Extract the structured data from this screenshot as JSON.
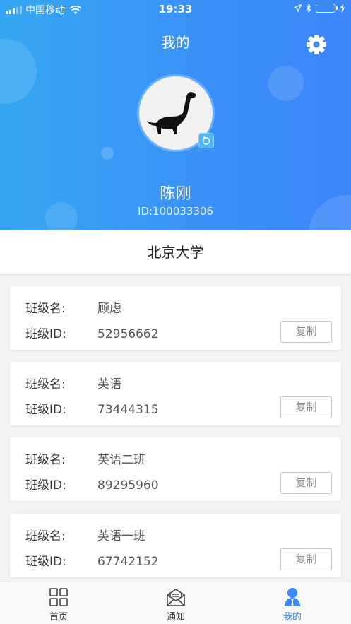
{
  "status_bar": {
    "carrier": "中国移动",
    "time": "19:33"
  },
  "header": {
    "title": "我的",
    "user_name": "陈刚",
    "user_id": "ID:100033306"
  },
  "school": "北京大学",
  "classes": [
    {
      "name_label": "班级名:",
      "name": "顾虑",
      "id_label": "班级ID:",
      "id": "52956662",
      "copy_label": "复制"
    },
    {
      "name_label": "班级名:",
      "name": "英语",
      "id_label": "班级ID:",
      "id": "73444315",
      "copy_label": "复制"
    },
    {
      "name_label": "班级名:",
      "name": "英语二班",
      "id_label": "班级ID:",
      "id": "89295960",
      "copy_label": "复制"
    },
    {
      "name_label": "班级名:",
      "name": "英语一班",
      "id_label": "班级ID:",
      "id": "67742152",
      "copy_label": "复制"
    }
  ],
  "tabs": [
    {
      "label": "首页",
      "icon": "grid-icon"
    },
    {
      "label": "通知",
      "icon": "envelope-icon"
    },
    {
      "label": "我的",
      "icon": "person-icon",
      "active": true
    }
  ],
  "colors": {
    "header_gradient_start": "#35a7f2",
    "header_gradient_end": "#3c86fa",
    "active_tab": "#3c88f5",
    "battery": "#4cd964"
  }
}
